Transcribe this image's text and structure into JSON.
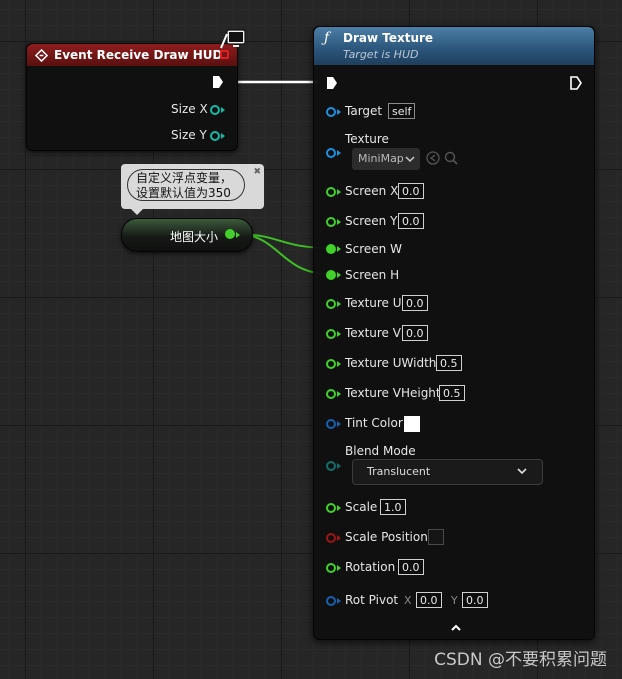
{
  "event_node": {
    "title": "Event Receive Draw HUD",
    "pins": [
      "Size X",
      "Size Y"
    ]
  },
  "comment": {
    "line1": "自定义浮点变量，",
    "line2": "设置默认值为350"
  },
  "variable_node": {
    "label": "地图大小"
  },
  "draw_texture": {
    "title": "Draw Texture",
    "subtitle": "Target is HUD",
    "target_label": "Target",
    "target_value": "self",
    "texture_label": "Texture",
    "texture_value": "MiniMap",
    "screen_x_label": "Screen X",
    "screen_x_value": "0.0",
    "screen_y_label": "Screen Y",
    "screen_y_value": "0.0",
    "screen_w_label": "Screen W",
    "screen_h_label": "Screen H",
    "texture_u_label": "Texture U",
    "texture_u_value": "0.0",
    "texture_v_label": "Texture V",
    "texture_v_value": "0.0",
    "texture_uwidth_label": "Texture UWidth",
    "texture_uwidth_value": "0.5",
    "texture_vheight_label": "Texture VHeight",
    "texture_vheight_value": "0.5",
    "tint_color_label": "Tint Color",
    "tint_color_value": "#ffffff",
    "blend_mode_label": "Blend Mode",
    "blend_mode_value": "Translucent",
    "scale_label": "Scale",
    "scale_value": "1.0",
    "scale_position_label": "Scale Position",
    "rotation_label": "Rotation",
    "rotation_value": "0.0",
    "rot_pivot_label": "Rot Pivot",
    "rot_pivot_x_label": "X",
    "rot_pivot_x_value": "0.0",
    "rot_pivot_y_label": "Y",
    "rot_pivot_y_value": "0.0"
  },
  "colors": {
    "exec_white": "#ffffff",
    "float_green": "#42d12b",
    "int_teal": "#17b8a6",
    "object_blue": "#1f8fe0",
    "event_red": "#8e1d1d",
    "function_blue": "#2a5478"
  },
  "watermark": "CSDN @不要积累问题"
}
